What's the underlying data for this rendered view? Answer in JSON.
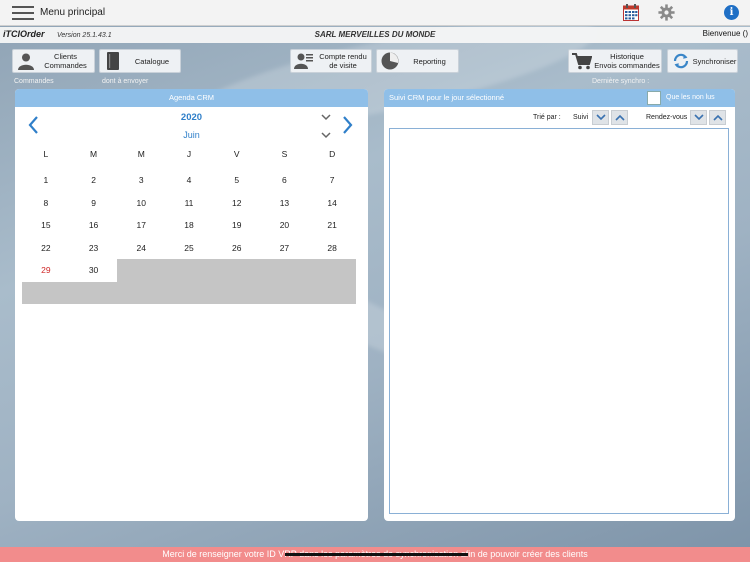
{
  "topbar": {
    "menu_label": "Menu principal",
    "calendar_icon": "calendar-icon",
    "settings_icon": "gear-icon",
    "info_icon": "info-icon",
    "info_glyph": "i"
  },
  "infostrip": {
    "app_name": "iTCIOrder",
    "version": "Version 25.1.43.1",
    "company": "SARL MERVEILLES DU MONDE",
    "welcome": "Bienvenue ()"
  },
  "toolbar": {
    "clients_label": "Clients\nCommandes",
    "catalogue_label": "Catalogue",
    "compte_rendu_label": "Compte rendu\nde visite",
    "reporting_label": "Reporting",
    "historique_label": "Historique\nEnvois commandes",
    "sync_label": "Synchroniser"
  },
  "sublabels": {
    "commandes": "Commandes",
    "dont_envoyer": "dont à envoyer",
    "derniere_synchro": "Dernière synchro :"
  },
  "agenda": {
    "title": "Agenda CRM",
    "year": "2020",
    "month": "Juin",
    "weekdays": [
      "L",
      "M",
      "M",
      "J",
      "V",
      "S",
      "D"
    ],
    "days": [
      {
        "n": "1",
        "red": false
      },
      {
        "n": "2",
        "red": false
      },
      {
        "n": "3",
        "red": false
      },
      {
        "n": "4",
        "red": false
      },
      {
        "n": "5",
        "red": false
      },
      {
        "n": "6",
        "red": false
      },
      {
        "n": "7",
        "red": false
      },
      {
        "n": "8",
        "red": false
      },
      {
        "n": "9",
        "red": false
      },
      {
        "n": "10",
        "red": false
      },
      {
        "n": "11",
        "red": false
      },
      {
        "n": "12",
        "red": false
      },
      {
        "n": "13",
        "red": false
      },
      {
        "n": "14",
        "red": false
      },
      {
        "n": "15",
        "red": false
      },
      {
        "n": "16",
        "red": false
      },
      {
        "n": "17",
        "red": false
      },
      {
        "n": "18",
        "red": false
      },
      {
        "n": "19",
        "red": false
      },
      {
        "n": "20",
        "red": false
      },
      {
        "n": "21",
        "red": false
      },
      {
        "n": "22",
        "red": false
      },
      {
        "n": "23",
        "red": false
      },
      {
        "n": "24",
        "red": false
      },
      {
        "n": "25",
        "red": false
      },
      {
        "n": "26",
        "red": false
      },
      {
        "n": "27",
        "red": false
      },
      {
        "n": "28",
        "red": false
      },
      {
        "n": "29",
        "red": true
      },
      {
        "n": "30",
        "red": false
      }
    ],
    "today_color": "#d02828",
    "accent_color": "#2f7fc9"
  },
  "suivi": {
    "title": "Suivi CRM pour le jour sélectionné",
    "unread_label": "Que les non lus",
    "sort_label": "Trié par :",
    "sort_suivi": "Suivi",
    "sort_rdv": "Rendez-vous"
  },
  "banner": {
    "text": "Merci de renseigner votre ID VRP dans les paramètres de synchronisation afin de pouvoir créer des clients",
    "color": "#f28c8c"
  }
}
